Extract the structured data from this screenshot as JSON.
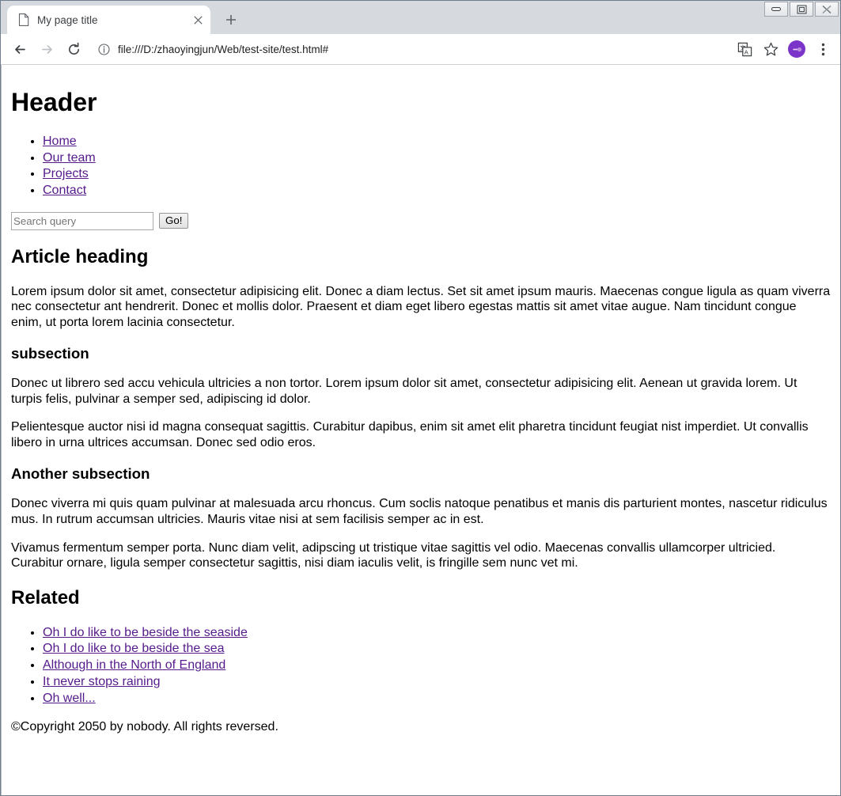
{
  "browser": {
    "tab": {
      "title": "My page title",
      "favicon_name": "page-document-icon",
      "close_label": "×"
    },
    "new_tab_label": "+",
    "window_controls": {
      "minimize": "minimize",
      "maximize": "maximize",
      "close": "close"
    },
    "nav": {
      "back": "back",
      "forward": "forward",
      "reload": "reload"
    },
    "omnibox": {
      "url": "file:///D:/zhaoyingjun/Web/test-site/test.html#",
      "info_icon": "page-info-icon"
    },
    "toolbar_icons": {
      "translate": "translate-icon",
      "bookmark": "star-icon",
      "profile": "profile-avatar",
      "menu": "three-dot-menu-icon"
    },
    "colors": {
      "tabstrip_bg": "#d6dade",
      "active_tab_bg": "#ffffff",
      "avatar_bg": "#7b35c9",
      "link": "#551a8b"
    }
  },
  "page": {
    "header_title": "Header",
    "nav_links": [
      "Home",
      "Our team",
      "Projects",
      "Contact"
    ],
    "search": {
      "placeholder": "Search query",
      "value": "",
      "button_label": "Go!"
    },
    "article": {
      "heading": "Article heading",
      "intro": "Lorem ipsum dolor sit amet, consectetur adipisicing elit. Donec a diam lectus. Set sit amet ipsum mauris. Maecenas congue ligula as quam viverra nec consectetur ant hendrerit. Donec et mollis dolor. Praesent et diam eget libero egestas mattis sit amet vitae augue. Nam tincidunt congue enim, ut porta lorem lacinia consectetur.",
      "sections": [
        {
          "heading": "subsection",
          "paragraphs": [
            "Donec ut librero sed accu vehicula ultricies a non tortor. Lorem ipsum dolor sit amet, consectetur adipisicing elit. Aenean ut gravida lorem. Ut turpis felis, pulvinar a semper sed, adipiscing id dolor.",
            "Pelientesque auctor nisi id magna consequat sagittis. Curabitur dapibus, enim sit amet elit pharetra tincidunt feugiat nist imperdiet. Ut convallis libero in urna ultrices accumsan. Donec sed odio eros."
          ]
        },
        {
          "heading": "Another subsection",
          "paragraphs": [
            "Donec viverra mi quis quam pulvinar at malesuada arcu rhoncus. Cum soclis natoque penatibus et manis dis parturient montes, nascetur ridiculus mus. In rutrum accumsan ultricies. Mauris vitae nisi at sem facilisis semper ac in est.",
            "Vivamus fermentum semper porta. Nunc diam velit, adipscing ut tristique vitae sagittis vel odio. Maecenas convallis ullamcorper ultricied. Curabitur ornare, ligula semper consectetur sagittis, nisi diam iaculis velit, is fringille sem nunc vet mi."
          ]
        }
      ]
    },
    "related": {
      "heading": "Related",
      "links": [
        "Oh I do like to be beside the seaside",
        "Oh I do like to be beside the sea",
        "Although in the North of England",
        "It never stops raining",
        "Oh well..."
      ]
    },
    "footer": "©Copyright 2050 by nobody. All rights reversed."
  }
}
